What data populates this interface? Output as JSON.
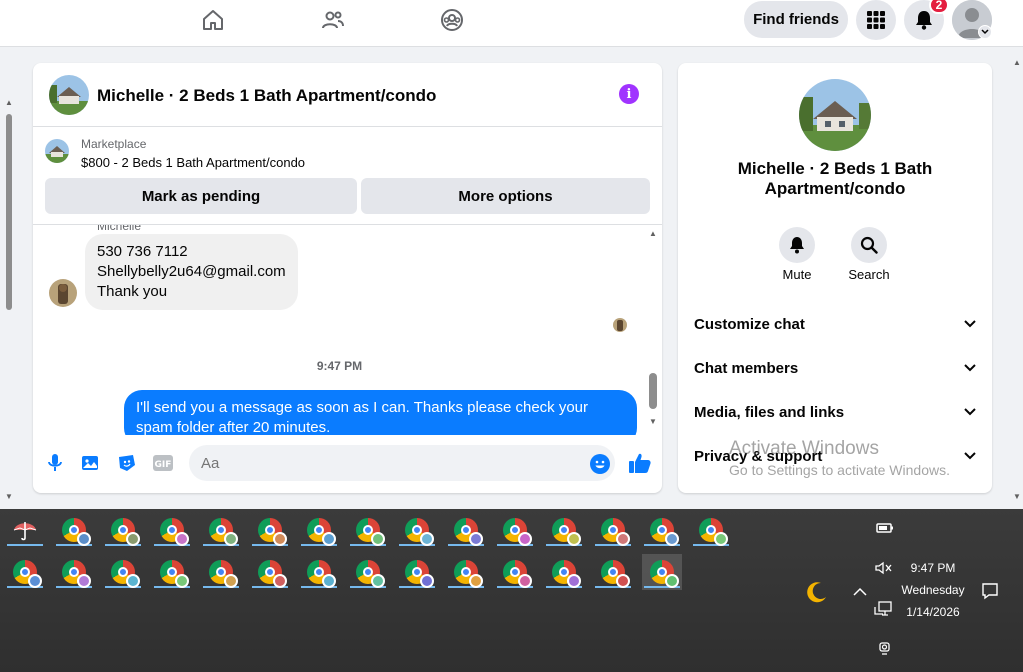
{
  "topbar": {
    "find_friends": "Find friends",
    "notification_count": "2",
    "icons": [
      "home-icon",
      "friends-icon",
      "groups-icon",
      "menu-grid-icon",
      "bell-icon",
      "account-icon"
    ]
  },
  "chat": {
    "title": "Michelle · 2 Beds 1 Bath Apartment/condo",
    "marketplace_label": "Marketplace",
    "listing": "$800 - 2 Beds 1 Bath Apartment/condo",
    "mark_pending": "Mark as pending",
    "more_options": "More options",
    "sender_name": "Michelle",
    "incoming_lines": [
      "530 736 7112",
      "Shellybelly2u64@gmail.com",
      "Thank you"
    ],
    "timestamp": "9:47 PM",
    "outgoing": "I'll send you a message as soon as I can. Thanks please check your spam folder after 20 minutes.",
    "composer_placeholder": "Aa"
  },
  "details": {
    "title": "Michelle · 2 Beds 1 Bath Apartment/condo",
    "mute": "Mute",
    "search": "Search",
    "rows": [
      "Customize chat",
      "Chat members",
      "Media, files and links",
      "Privacy & support"
    ]
  },
  "watermark": {
    "line1": "Activate Windows",
    "line2": "Go to Settings to activate Windows."
  },
  "taskbar": {
    "time": "9:47 PM",
    "day": "Wednesday",
    "date": "1/14/2026",
    "profile_colors_row1": [
      "#5b8ec9",
      "#8a9b6e",
      "#c874c8",
      "#7fb27f",
      "#d18b5a",
      "#5a9ed1",
      "#6fc07a",
      "#6cb4d6",
      "#7b7bd6",
      "#c864c8",
      "#c0c050",
      "#d07878",
      "#6a9ad0",
      "#78c878"
    ],
    "profile_colors_row2": [
      "#5a8fd6",
      "#b07ad6",
      "#5ab4d0",
      "#78c878",
      "#d0a050",
      "#d06060",
      "#5ab0d0",
      "#60c0a0",
      "#7070d6",
      "#e0a040",
      "#d060a0",
      "#a070d6",
      "#d05050",
      "#60c070"
    ]
  }
}
